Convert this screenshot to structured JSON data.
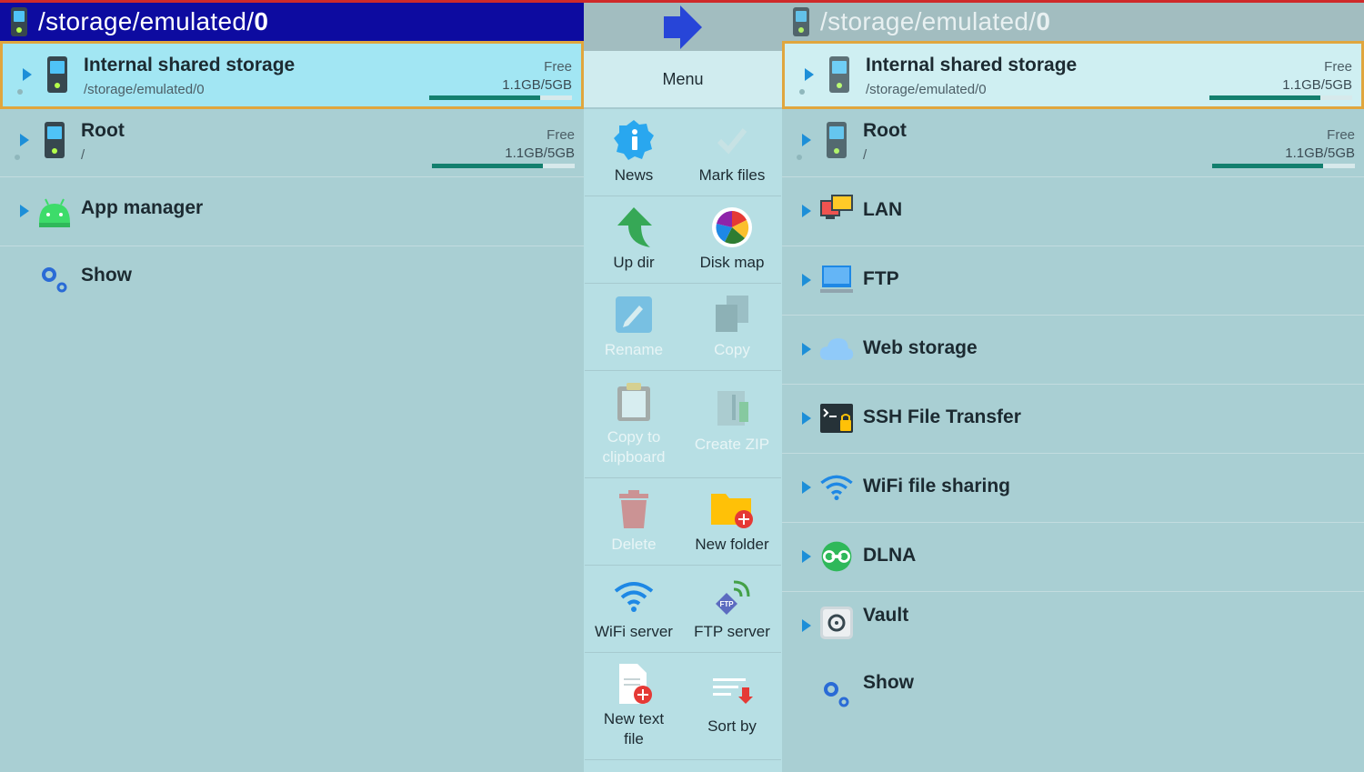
{
  "left_pane": {
    "header": {
      "path_prefix": "/storage/emulated/",
      "path_last": "0"
    },
    "items": [
      {
        "title": "Internal shared storage",
        "subtitle": "/storage/emulated/0",
        "free_label": "Free",
        "free_size": "1.1GB/5GB",
        "usage_fraction": 0.78
      },
      {
        "title": "Root",
        "subtitle": "/",
        "free_label": "Free",
        "free_size": "1.1GB/5GB",
        "usage_fraction": 0.78
      },
      {
        "title": "App manager"
      },
      {
        "title": "Show"
      }
    ]
  },
  "menu": {
    "title": "Menu",
    "items": [
      {
        "label": "News",
        "icon": "info-icon",
        "enabled": true
      },
      {
        "label": "Mark files",
        "icon": "checkmark-icon",
        "enabled": true
      },
      {
        "label": "Up dir",
        "icon": "up-arrow-icon",
        "enabled": true
      },
      {
        "label": "Disk map",
        "icon": "pie-chart-icon",
        "enabled": true
      },
      {
        "label": "Rename",
        "icon": "pencil-icon",
        "enabled": false
      },
      {
        "label": "Copy",
        "icon": "copy-icon",
        "enabled": false
      },
      {
        "label": "Copy to clipboard",
        "icon": "clipboard-icon",
        "enabled": false
      },
      {
        "label": "Create ZIP",
        "icon": "zip-icon",
        "enabled": false
      },
      {
        "label": "Delete",
        "icon": "trash-icon",
        "enabled": false
      },
      {
        "label": "New folder",
        "icon": "new-folder-icon",
        "enabled": true
      },
      {
        "label": "WiFi server",
        "icon": "wifi-icon",
        "enabled": true
      },
      {
        "label": "FTP server",
        "icon": "ftp-icon",
        "enabled": true
      },
      {
        "label": "New text file",
        "icon": "new-file-icon",
        "enabled": true
      },
      {
        "label": "Sort by",
        "icon": "sort-icon",
        "enabled": true
      }
    ]
  },
  "right_pane": {
    "header": {
      "path_prefix": "/storage/emulated/",
      "path_last": "0"
    },
    "items": [
      {
        "title": "Internal shared storage",
        "subtitle": "/storage/emulated/0",
        "free_label": "Free",
        "free_size": "1.1GB/5GB",
        "usage_fraction": 0.78
      },
      {
        "title": "Root",
        "subtitle": "/",
        "free_label": "Free",
        "free_size": "1.1GB/5GB",
        "usage_fraction": 0.78
      },
      {
        "title": "LAN"
      },
      {
        "title": "FTP"
      },
      {
        "title": "Web storage"
      },
      {
        "title": "SSH File Transfer"
      },
      {
        "title": "WiFi file sharing"
      },
      {
        "title": "DLNA"
      },
      {
        "title": "Vault"
      },
      {
        "title": "Show"
      }
    ]
  },
  "colors": {
    "accent_blue": "#1d8fd8",
    "selection_border": "#e0a63e",
    "active_header": "#0d0ba0",
    "usage_bar": "#137f6e"
  }
}
